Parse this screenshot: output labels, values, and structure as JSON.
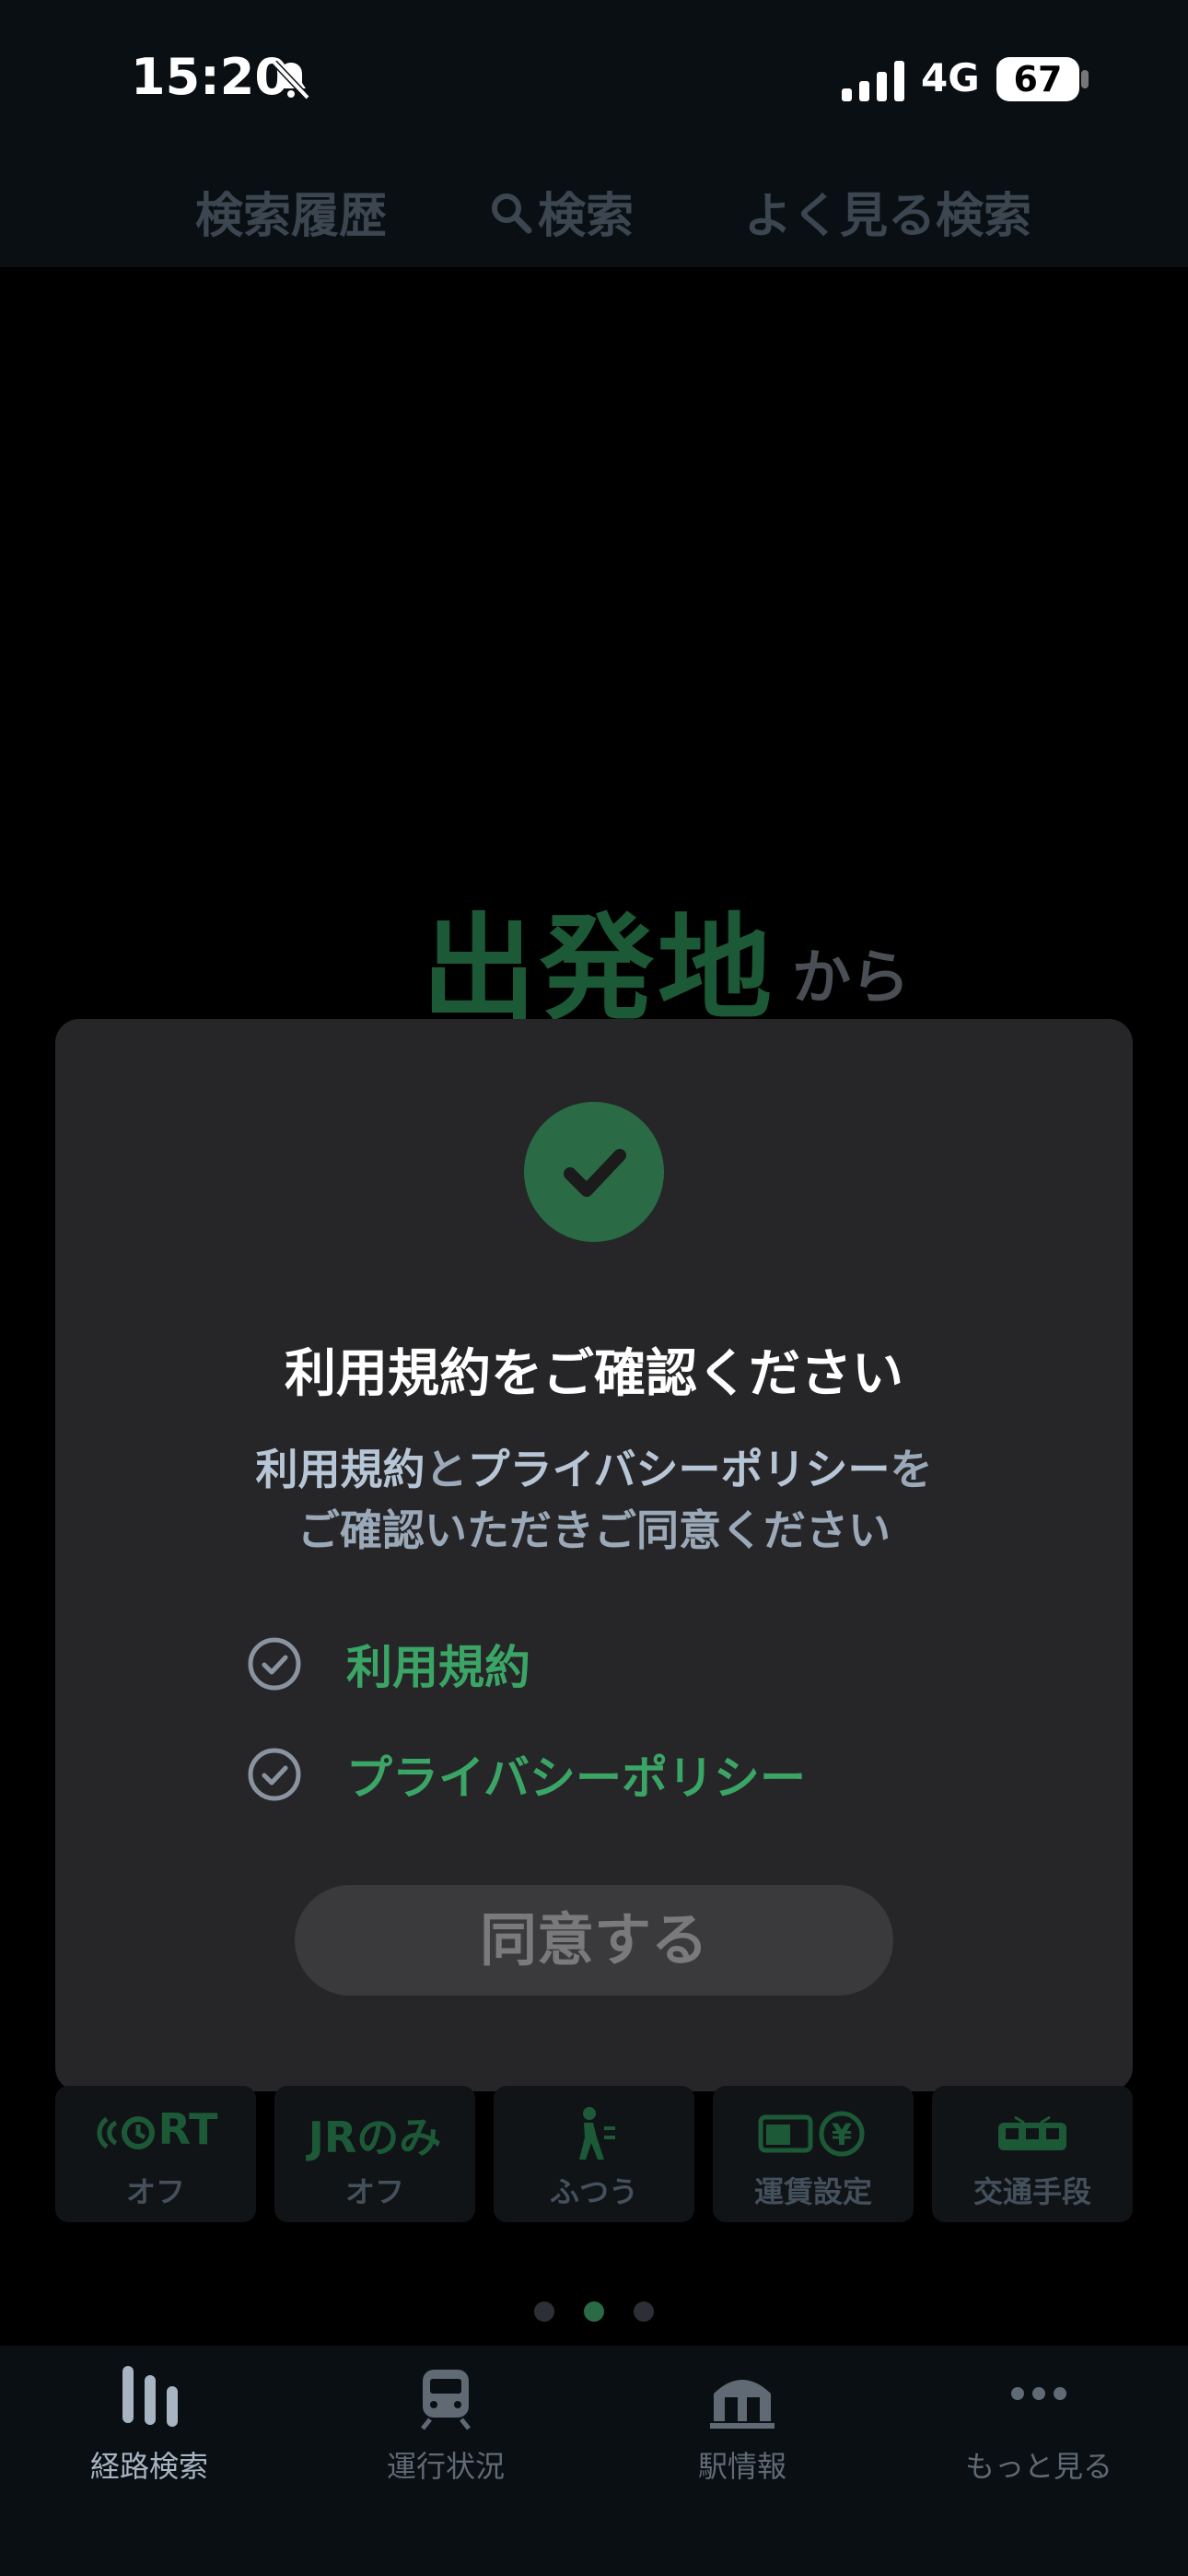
{
  "status_bar": {
    "time": "15:20",
    "network": "4G",
    "battery": "67"
  },
  "top_nav": {
    "history": "検索履歴",
    "search": "検索",
    "frequent": "よく見る検索"
  },
  "main": {
    "origin_title": "出発地",
    "origin_suffix": "から"
  },
  "dialog": {
    "title": "利用規約をご確認ください",
    "body_terms": "利用規約",
    "body_and": "と",
    "body_privacy": "プライバシーポリシー",
    "body_wo": "を",
    "body_line2": "ご確認いただきご同意ください",
    "check_terms": "利用規約",
    "check_privacy": "プライバシーポリシー",
    "agree_button": "同意する"
  },
  "options": {
    "realtime": {
      "icon_text": "RT",
      "label": "オフ"
    },
    "jr_only": {
      "icon_text": "JRのみ",
      "label": "オフ"
    },
    "walk": {
      "label": "ふつう"
    },
    "fare": {
      "label": "運賃設定"
    },
    "transport": {
      "label": "交通手段"
    }
  },
  "pager": {
    "total": 3,
    "active": 2
  },
  "tab_bar": {
    "route": "経路検索",
    "status": "運行状況",
    "station": "駅情報",
    "more": "もっと見る"
  },
  "colors": {
    "accent": "#2a6b45",
    "link_green": "#3aa565"
  }
}
